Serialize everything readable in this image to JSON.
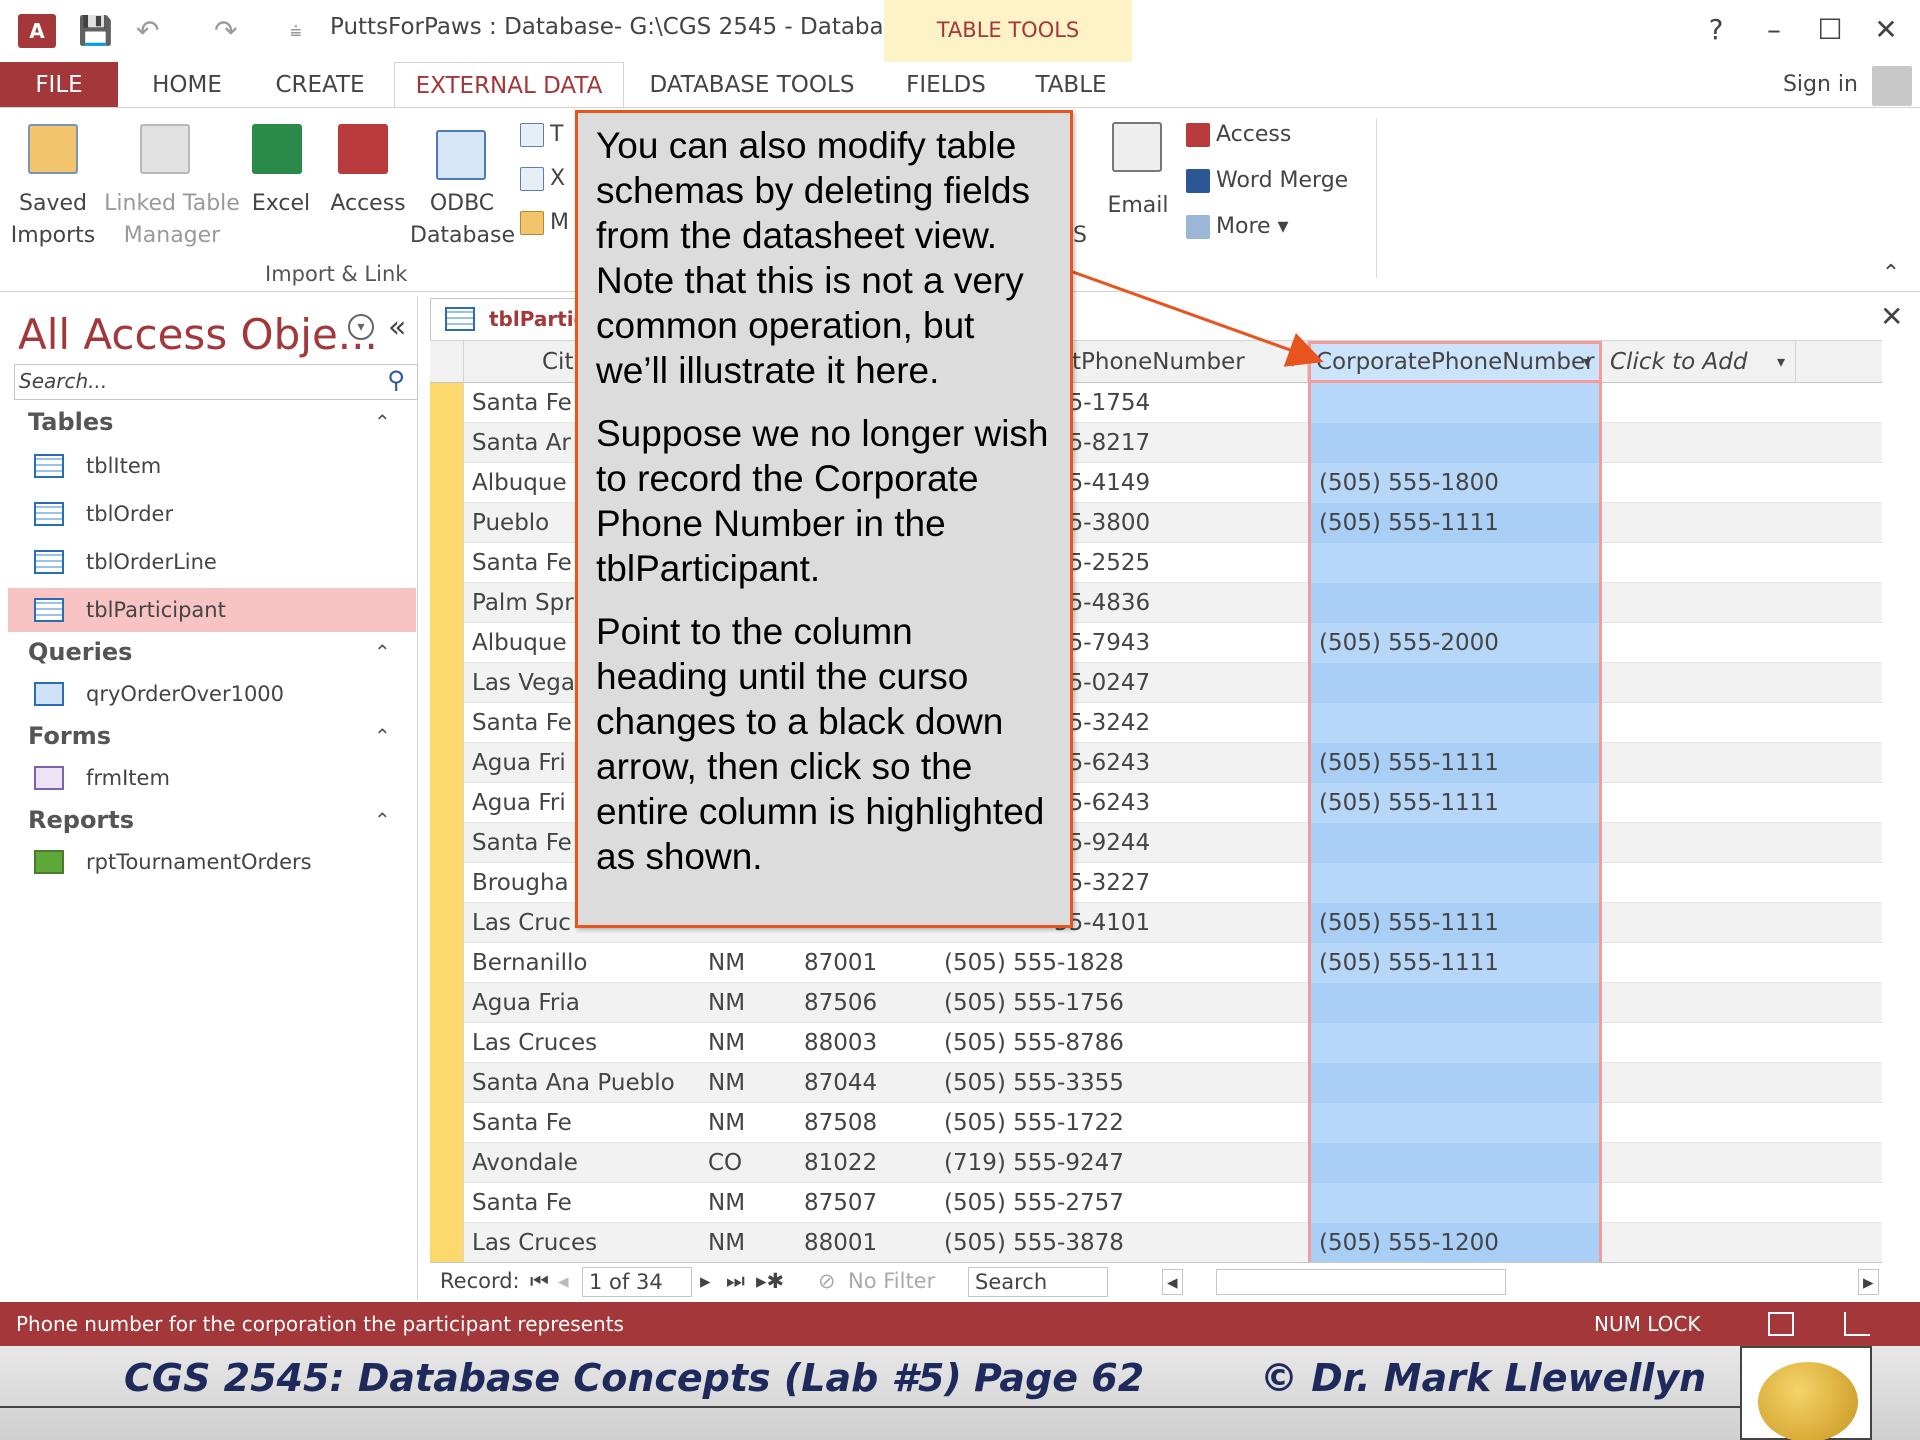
{
  "window": {
    "title": "PuttsForPaws : Database- G:\\CGS 2545 - Databas...",
    "table_tools": "TABLE TOOLS",
    "help": "?",
    "minimize": "–",
    "restore": "☐",
    "close": "✕"
  },
  "tabs": {
    "file": "FILE",
    "home": "HOME",
    "create": "CREATE",
    "external_data": "EXTERNAL DATA",
    "database_tools": "DATABASE TOOLS",
    "fields": "FIELDS",
    "table": "TABLE",
    "sign_in": "Sign in"
  },
  "ribbon": {
    "saved_imports": [
      "Saved",
      "Imports"
    ],
    "linked_table_manager": [
      "Linked Table",
      "Manager"
    ],
    "excel": "Excel",
    "access": "Access",
    "odbc": [
      "ODBC",
      "Database"
    ],
    "small_left": [
      "T",
      "X",
      "M"
    ],
    "email": "Email",
    "export_access": "Access",
    "word_merge": "Word Merge",
    "more": "More ▾",
    "s_fragment": "S",
    "group_label": "Import & Link",
    "collapse": "⌃"
  },
  "nav": {
    "title": "All Access Obje...",
    "search_placeholder": "Search...",
    "sections": {
      "tables": "Tables",
      "queries": "Queries",
      "forms": "Forms",
      "reports": "Reports"
    },
    "tables": [
      "tblItem",
      "tblOrder",
      "tblOrderLine",
      "tblParticipant"
    ],
    "queries": [
      "qryOrderOver1000"
    ],
    "forms": [
      "frmItem"
    ],
    "reports": [
      "rptTournamentOrders"
    ]
  },
  "document": {
    "tab_label": "tblPartic",
    "columns": {
      "city": "Cit",
      "contact_phone": "tPhoneNumber",
      "corporate_phone": "CorporatePhoneNumber",
      "click_to_add": "Click to Add"
    },
    "rows": [
      {
        "city": "Santa Fe",
        "state": "",
        "zip": "",
        "phone": "55-1754",
        "corp": ""
      },
      {
        "city": "Santa Ar",
        "state": "",
        "zip": "",
        "phone": "55-8217",
        "corp": ""
      },
      {
        "city": "Albuque",
        "state": "",
        "zip": "",
        "phone": "55-4149",
        "corp": "(505) 555-1800"
      },
      {
        "city": "Pueblo",
        "state": "",
        "zip": "",
        "phone": "55-3800",
        "corp": "(505) 555-1111"
      },
      {
        "city": "Santa Fe",
        "state": "",
        "zip": "",
        "phone": "55-2525",
        "corp": ""
      },
      {
        "city": "Palm Spr",
        "state": "",
        "zip": "",
        "phone": "55-4836",
        "corp": ""
      },
      {
        "city": "Albuque",
        "state": "",
        "zip": "",
        "phone": "55-7943",
        "corp": "(505) 555-2000"
      },
      {
        "city": "Las Vega",
        "state": "",
        "zip": "",
        "phone": "55-0247",
        "corp": ""
      },
      {
        "city": "Santa Fe",
        "state": "",
        "zip": "",
        "phone": "55-3242",
        "corp": ""
      },
      {
        "city": "Agua Fri",
        "state": "",
        "zip": "",
        "phone": "55-6243",
        "corp": "(505) 555-1111"
      },
      {
        "city": "Agua Fri",
        "state": "",
        "zip": "",
        "phone": "55-6243",
        "corp": "(505) 555-1111"
      },
      {
        "city": "Santa Fe",
        "state": "",
        "zip": "",
        "phone": "55-9244",
        "corp": ""
      },
      {
        "city": "Brougha",
        "state": "",
        "zip": "",
        "phone": "55-3227",
        "corp": ""
      },
      {
        "city": "Las Cruc",
        "state": "",
        "zip": "",
        "phone": "55-4101",
        "corp": "(505) 555-1111"
      },
      {
        "city": "Bernanillo",
        "state": "NM",
        "zip": "87001",
        "phone": "(505) 555-1828",
        "corp": "(505) 555-1111"
      },
      {
        "city": "Agua Fria",
        "state": "NM",
        "zip": "87506",
        "phone": "(505) 555-1756",
        "corp": ""
      },
      {
        "city": "Las Cruces",
        "state": "NM",
        "zip": "88003",
        "phone": "(505) 555-8786",
        "corp": ""
      },
      {
        "city": "Santa Ana Pueblo",
        "state": "NM",
        "zip": "87044",
        "phone": "(505) 555-3355",
        "corp": ""
      },
      {
        "city": "Santa Fe",
        "state": "NM",
        "zip": "87508",
        "phone": "(505) 555-1722",
        "corp": ""
      },
      {
        "city": "Avondale",
        "state": "CO",
        "zip": "81022",
        "phone": "(719) 555-9247",
        "corp": ""
      },
      {
        "city": "Santa Fe",
        "state": "NM",
        "zip": "87507",
        "phone": "(505) 555-2757",
        "corp": ""
      },
      {
        "city": "Las Cruces",
        "state": "NM",
        "zip": "88001",
        "phone": "(505) 555-3878",
        "corp": "(505) 555-1200"
      }
    ]
  },
  "record_nav": {
    "label": "Record:",
    "position": "1 of 34",
    "no_filter": "No Filter",
    "search": "Search"
  },
  "status": {
    "text": "Phone number for the corporation the participant represents",
    "num_lock": "NUM LOCK"
  },
  "footer": {
    "course": "CGS 2545: Database Concepts  (Lab #5)",
    "page": "Page 62",
    "author": "© Dr. Mark Llewellyn"
  },
  "callout": {
    "p1": "You can also modify table schemas by deleting fields from the datasheet view.  Note that this is not a very common operation, but we’ll illustrate it here.",
    "p2": "Suppose we no longer wish to record the Corporate Phone Number in the tblParticipant.",
    "p3": "Point to the column heading until the curso changes to a black down arrow, then click so the entire column is highlighted as shown."
  },
  "colors": {
    "access_red": "#a4373a",
    "table_tools_band": "#fdf3c7",
    "selected_column": "#b7d7f8",
    "callout_border": "#e8541e",
    "record_selector": "#fdd96b"
  }
}
